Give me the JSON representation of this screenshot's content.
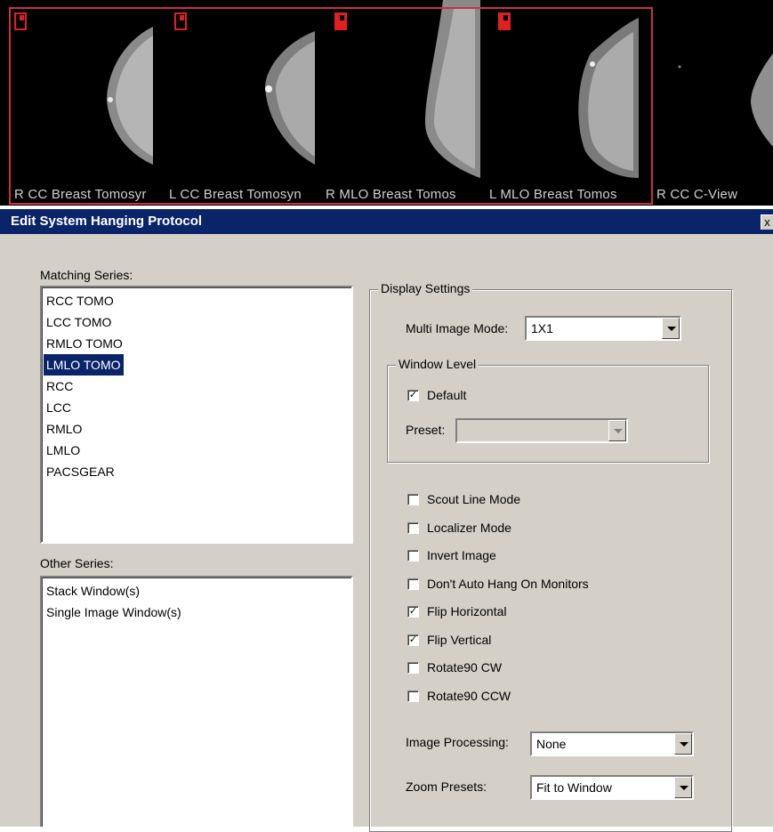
{
  "thumbnails": [
    {
      "label": "R CC Breast Tomosyr",
      "marker": "outline"
    },
    {
      "label": "L CC Breast Tomosyn",
      "marker": "outline"
    },
    {
      "label": "R MLO Breast Tomos",
      "marker": "filled"
    },
    {
      "label": "L MLO Breast Tomos",
      "marker": "filled"
    },
    {
      "label": "R CC C-View",
      "marker": "none"
    }
  ],
  "colors": {
    "titlebar": "#0a246a",
    "selection_frame": "#c8323a",
    "dialog_bg": "#d4d0c8"
  },
  "dialog": {
    "title": "Edit System Hanging Protocol",
    "close_glyph": "x",
    "matching_series_label": "Matching Series:",
    "matching_series": [
      "RCC TOMO",
      "LCC TOMO",
      "RMLO TOMO",
      "LMLO TOMO",
      "RCC",
      "LCC",
      "RMLO",
      "LMLO",
      "PACSGEAR"
    ],
    "matching_series_selected": "LMLO TOMO",
    "other_series_label": "Other Series:",
    "other_series": [
      "Stack Window(s)",
      "Single Image Window(s)"
    ],
    "display_settings": {
      "legend": "Display Settings",
      "multi_image_mode_label": "Multi Image Mode:",
      "multi_image_mode_value": "1X1",
      "window_level": {
        "legend": "Window Level",
        "default_label": "Default",
        "default_checked": true,
        "preset_label": "Preset:",
        "preset_value": ""
      },
      "options": [
        {
          "label": "Scout Line Mode",
          "checked": false
        },
        {
          "label": "Localizer Mode",
          "checked": false
        },
        {
          "label": "Invert Image",
          "checked": false
        },
        {
          "label": "Don't Auto Hang On Monitors",
          "checked": false
        },
        {
          "label": "Flip Horizontal",
          "checked": true
        },
        {
          "label": "Flip Vertical",
          "checked": true
        },
        {
          "label": "Rotate90 CW",
          "checked": false
        },
        {
          "label": "Rotate90 CCW",
          "checked": false
        }
      ],
      "image_processing_label": "Image Processing:",
      "image_processing_value": "None",
      "zoom_presets_label": "Zoom Presets:",
      "zoom_presets_value": "Fit to Window"
    }
  }
}
